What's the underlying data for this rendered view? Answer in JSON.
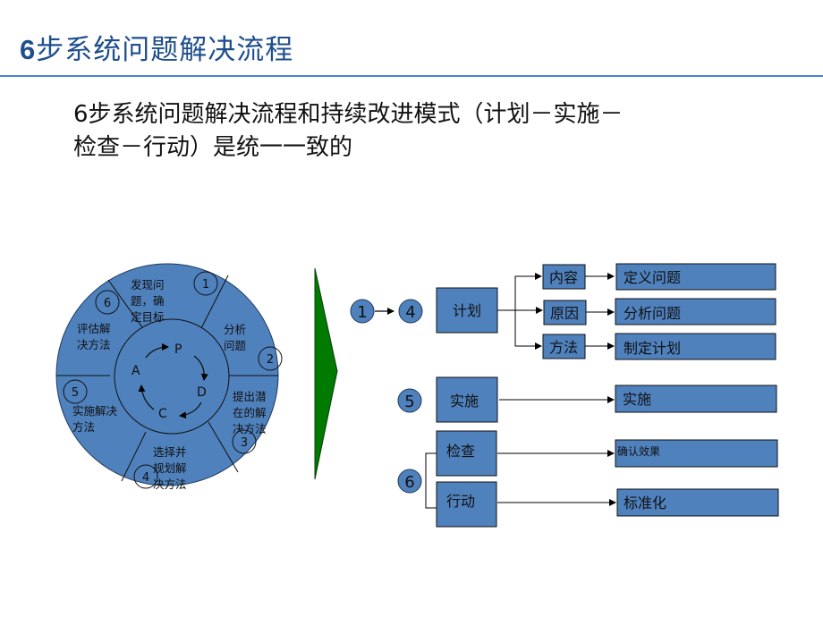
{
  "header": {
    "title_num": "6",
    "title_text": "步系统问题解决流程"
  },
  "subtitle": {
    "line1": "6步系统问题解决流程和持续改进模式（计划－实施－",
    "line2": "检查－行动）是统一一致的"
  },
  "wheel": {
    "segments": [
      {
        "step": "1",
        "lines": [
          "发现问",
          "题，确",
          "定目标"
        ]
      },
      {
        "step": "2",
        "lines": [
          "分析",
          "问题"
        ]
      },
      {
        "step": "3",
        "lines": [
          "提出潜",
          "在的解",
          "决方法"
        ]
      },
      {
        "step": "4",
        "lines": [
          "选择并",
          "规划解",
          "决方法"
        ]
      },
      {
        "step": "5",
        "lines": [
          "实施解决",
          "方法"
        ]
      },
      {
        "step": "6",
        "lines": [
          "评估解",
          "决方法"
        ]
      }
    ],
    "pdca": {
      "p": "P",
      "d": "D",
      "c": "C",
      "a": "A"
    }
  },
  "flow": {
    "plan": {
      "from_step": "1",
      "to_step": "4",
      "label": "计划",
      "branches": [
        {
          "category": "内容",
          "result": "定义问题"
        },
        {
          "category": "原因",
          "result": "分析问题"
        },
        {
          "category": "方法",
          "result": "制定计划"
        }
      ]
    },
    "do": {
      "step": "5",
      "label": "实施",
      "result": "实施"
    },
    "check_act": {
      "step": "6",
      "check": {
        "label": "检查",
        "result": "确认效果"
      },
      "act": {
        "label": "行动",
        "result": "标准化"
      }
    }
  },
  "colors": {
    "accent_blue": "#4f81bd",
    "title_blue": "#1f4e8c",
    "rule_blue": "#4a86c8",
    "arrow_green": "#007a00"
  }
}
